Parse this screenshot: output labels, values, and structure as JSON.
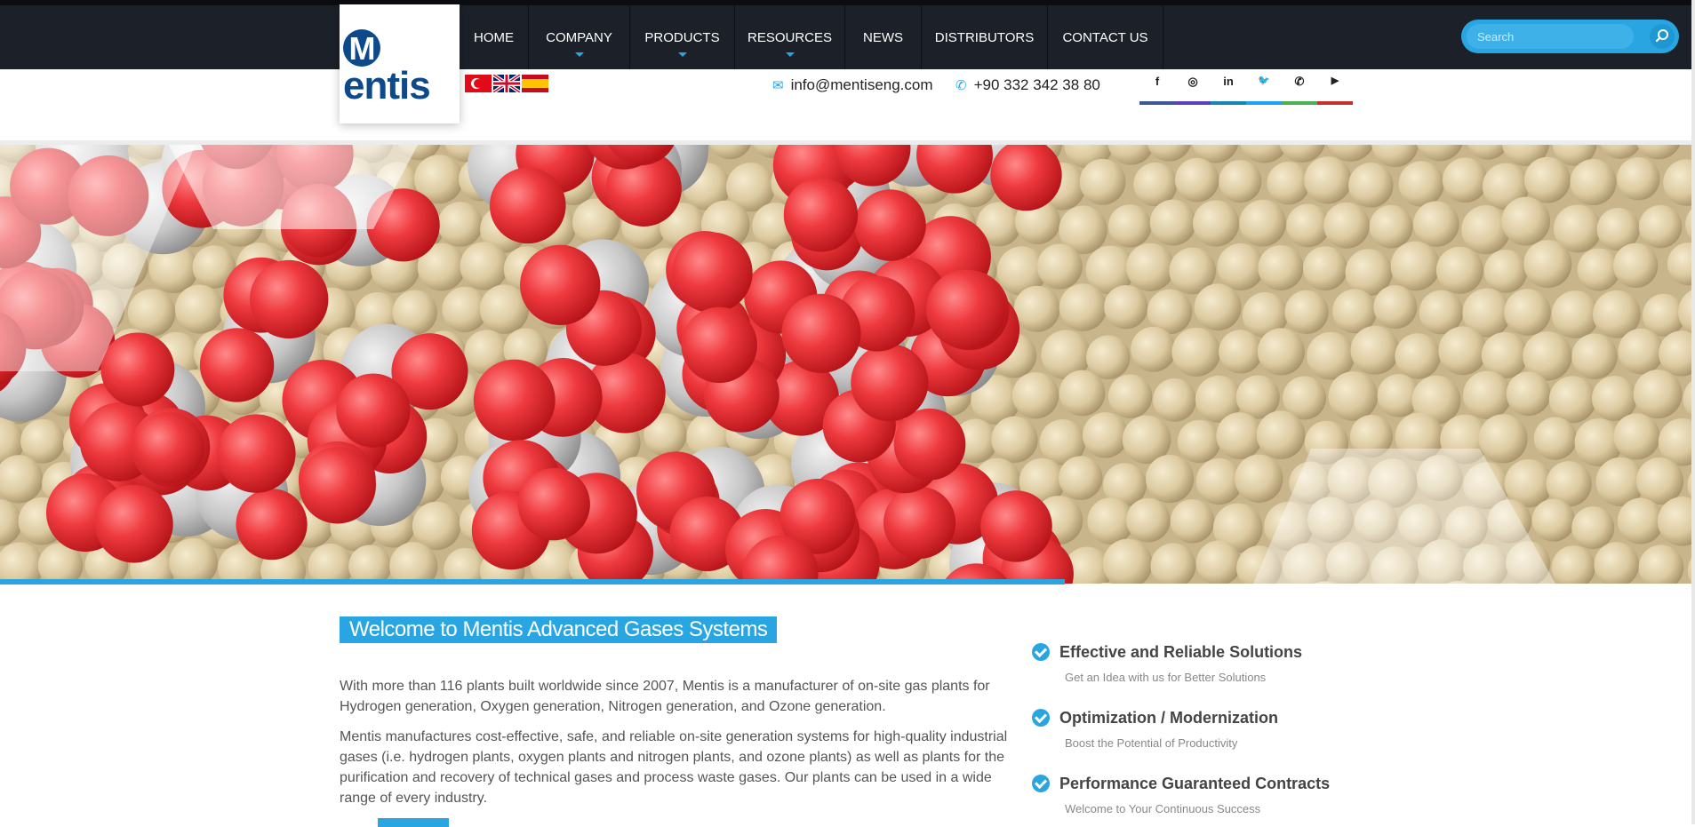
{
  "brand": {
    "logo_text": "entis",
    "logo_initial": "M"
  },
  "nav": {
    "items": [
      {
        "label": "HOME",
        "dropdown": false
      },
      {
        "label": "COMPANY",
        "dropdown": true
      },
      {
        "label": "PRODUCTS",
        "dropdown": true
      },
      {
        "label": "RESOURCES",
        "dropdown": true
      },
      {
        "label": "NEWS",
        "dropdown": false
      },
      {
        "label": "DISTRIBUTORS",
        "dropdown": false
      },
      {
        "label": "CONTACT US",
        "dropdown": false
      }
    ]
  },
  "search": {
    "placeholder": "Search"
  },
  "contact": {
    "email": "info@mentiseng.com",
    "phone": "+90 332 342 38 80"
  },
  "social": {
    "icons": [
      "facebook-icon",
      "instagram-icon",
      "linkedin-icon",
      "twitter-icon",
      "whatsapp-icon",
      "youtube-icon"
    ],
    "glyphs": [
      "f",
      "◎",
      "in",
      "🐦",
      "✆",
      "▶"
    ],
    "underline_colors": [
      "#3b5998",
      "#5b3fbe",
      "#1686b0",
      "#1da1f2",
      "#4caf50",
      "#c4302b"
    ]
  },
  "welcome": {
    "heading": "Welcome to Mentis Advanced Gases Systems",
    "paragraph1": "With more than 116 plants built worldwide since 2007, Mentis is a manufacturer of on-site gas plants for Hydrogen generation, Oxygen generation, Nitrogen generation, and Ozone generation.",
    "paragraph2": "Mentis manufactures cost-effective, safe, and reliable on-site generation systems for high-quality industrial gases (i.e. hydrogen plants, oxygen plants and nitrogen plants, and ozone plants) as well as plants for the purification and recovery of technical gases and process waste gases. Our plants can be used in a wide range of every industry."
  },
  "features": [
    {
      "title": "Effective and Reliable Solutions",
      "subtitle": "Get an Idea with us for Better Solutions"
    },
    {
      "title": "Optimization / Modernization",
      "subtitle": "Boost the Potential of Productivity"
    },
    {
      "title": "Performance Guaranteed Contracts",
      "subtitle": "Welcome to Your Continuous Success"
    }
  ],
  "colors": {
    "accent": "#29a6e2",
    "nav_bg": "#1b2029"
  }
}
